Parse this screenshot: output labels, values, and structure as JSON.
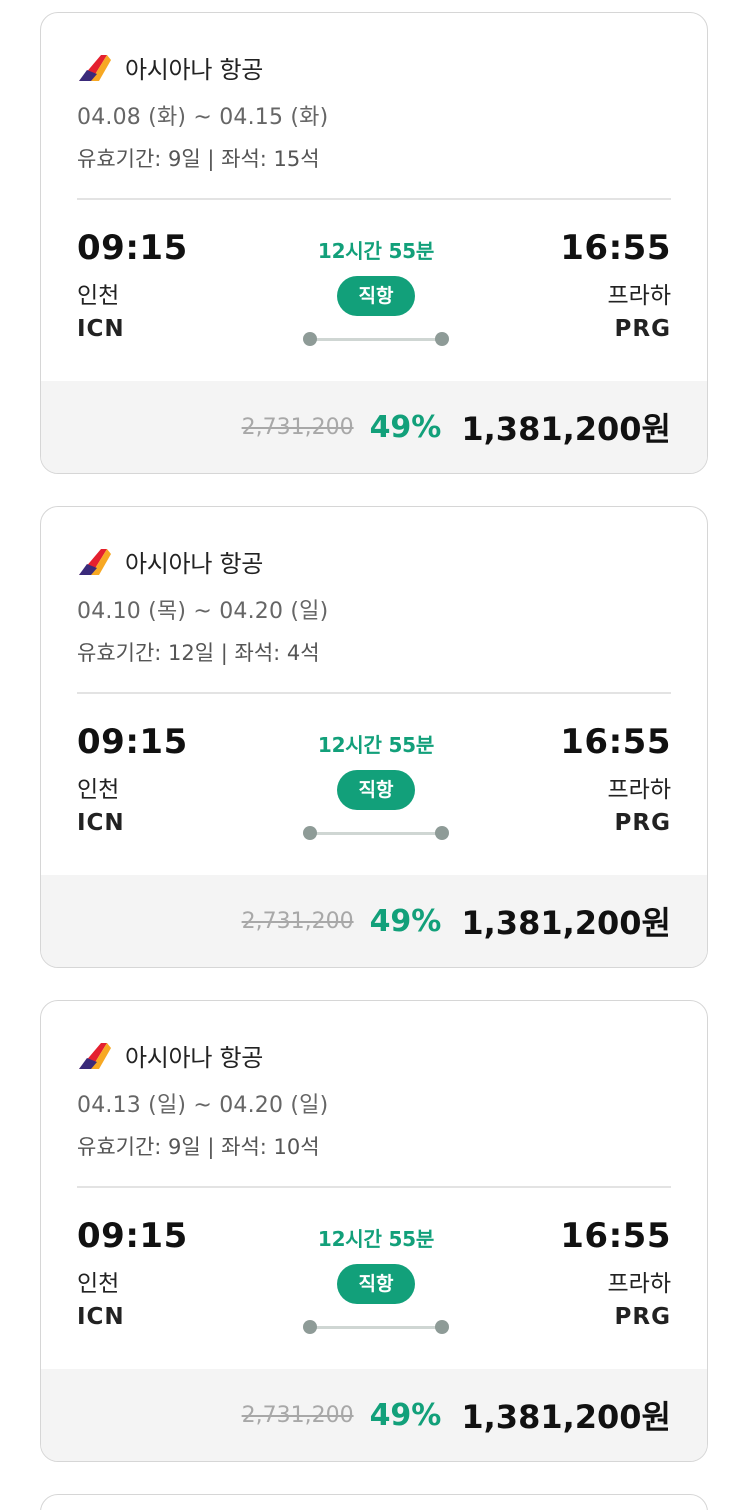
{
  "colors": {
    "accent": "#12a07a",
    "card_border": "#d6d6d6",
    "price_bg": "#f4f4f4",
    "strike_text": "#a8a8a8"
  },
  "cards": [
    {
      "airline": "아시아나 항공",
      "logo_icon": "asiana-airlines-logo",
      "dates": "04.08 (화) ~ 04.15 (화)",
      "meta": "유효기간: 9일 | 좌석: 15석",
      "dep_time": "09:15",
      "dep_city": "인천",
      "dep_code": "ICN",
      "duration": "12시간 55분",
      "flight_type": "직항",
      "arr_time": "16:55",
      "arr_city": "프라하",
      "arr_code": "PRG",
      "original_price": "2,731,200",
      "discount": "49%",
      "final_price": "1,381,200원"
    },
    {
      "airline": "아시아나 항공",
      "logo_icon": "asiana-airlines-logo",
      "dates": "04.10 (목) ~ 04.20 (일)",
      "meta": "유효기간: 12일 | 좌석: 4석",
      "dep_time": "09:15",
      "dep_city": "인천",
      "dep_code": "ICN",
      "duration": "12시간 55분",
      "flight_type": "직항",
      "arr_time": "16:55",
      "arr_city": "프라하",
      "arr_code": "PRG",
      "original_price": "2,731,200",
      "discount": "49%",
      "final_price": "1,381,200원"
    },
    {
      "airline": "아시아나 항공",
      "logo_icon": "asiana-airlines-logo",
      "dates": "04.13 (일) ~ 04.20 (일)",
      "meta": "유효기간: 9일 | 좌석: 10석",
      "dep_time": "09:15",
      "dep_city": "인천",
      "dep_code": "ICN",
      "duration": "12시간 55분",
      "flight_type": "직항",
      "arr_time": "16:55",
      "arr_city": "프라하",
      "arr_code": "PRG",
      "original_price": "2,731,200",
      "discount": "49%",
      "final_price": "1,381,200원"
    }
  ]
}
